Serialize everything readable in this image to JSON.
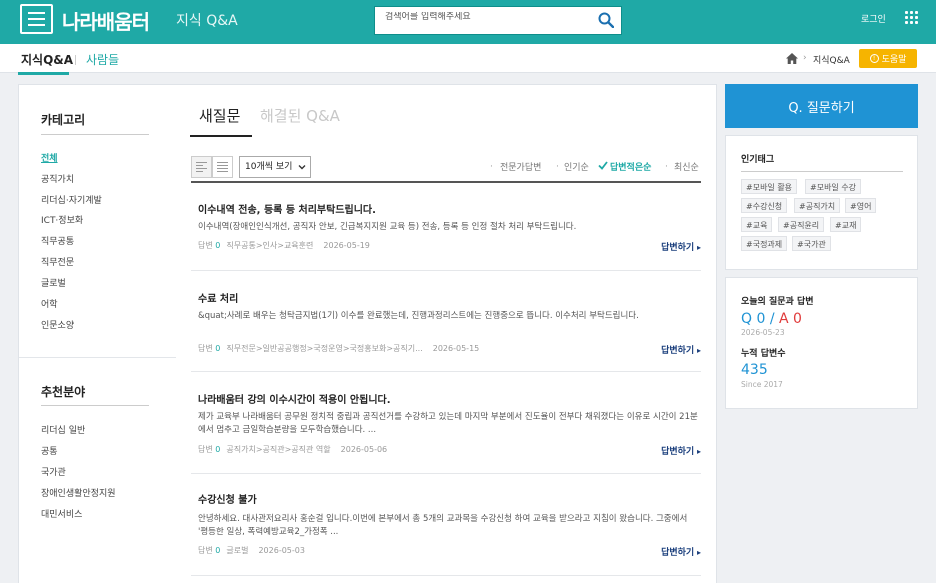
{
  "header": {
    "logo": "나라배움터",
    "section": "지식 Q&A",
    "search_placeholder": "검색어를 입력해주세요",
    "login_label": "로그인"
  },
  "subnav": {
    "tabs": [
      "지식Q&A",
      "사람들"
    ],
    "breadcrumb": "지식Q&A",
    "help_label": "도움말"
  },
  "sidebar": {
    "category_title": "카테고리",
    "categories": [
      "전체",
      "공직가치",
      "리더십·자기계발",
      "ICT·정보화",
      "직무공통",
      "직무전문",
      "글로벌",
      "어학",
      "인문소양"
    ],
    "recommend_title": "추천분야",
    "recommends": [
      "리더십 일반",
      "공통",
      "국가관",
      "장애인생활안정지원",
      "대민서비스"
    ]
  },
  "content": {
    "tabs": [
      "새질문",
      "해결된 Q&A"
    ],
    "per_page": "10개씩 보기",
    "sorts": [
      "전문가답변",
      "인기순",
      "답변적은순",
      "최신순"
    ],
    "active_sort": "답변적은순",
    "answer_label": "답변하기",
    "reply_prefix": "답변",
    "questions": [
      {
        "title": "이수내역 전송, 등록 등 처리부탁드립니다.",
        "body": "이수내역(장애인인식개선, 공직자 안보, 긴급복지지원 교육 등) 전송, 등록 등 인정 절차 처리 부탁드립니다.",
        "answers": "0",
        "category": "직무공통>인사>교육훈련",
        "date": "2026-05-19"
      },
      {
        "title": "수료 처리",
        "body": "&quat;사례로 배우는 청탁금지법(1기) 이수를 완료했는데, 진행과정리스트에는 진행중으로 뜹니다. 이수처리 부탁드립니다.",
        "answers": "0",
        "category": "직무전문>일반공공행정>국정운영>국정홍보화>공직기...",
        "date": "2026-05-15"
      },
      {
        "title": "나라배움터 강의 이수시간이 적용이 안됩니다.",
        "body": "제가 교육부 나라배움터 공무원 정치적 중립과 공직선거를 수강하고 있는데 마지막 부분에서 진도율이 전부다 채워졌다는 이유로 시간이 21분에서 멈추고 금일학습분량을 모두학습했습니다. ...",
        "answers": "0",
        "category": "공직가치>공직관>공직관 역할",
        "date": "2026-05-06"
      },
      {
        "title": "수강신청 불가",
        "body": "안녕하세요. 대사관저요리사 홍순걸 입니다.이번에 본부에서 총 5개의 교과목을 수강신청 하여 교육을 받으라고 지침이 왔습니다. 그중에서 '평등한 일상, 폭력예방교육2_가정폭 ...",
        "answers": "0",
        "category": "글로벌",
        "date": "2026-05-03"
      }
    ]
  },
  "right": {
    "ask_label": "Q. 질문하기",
    "tags_title": "인기태그",
    "tags": [
      "#모바일 활용",
      "#모바일 수강",
      "#수강신청",
      "#공직가치",
      "#영어",
      "#교육",
      "#공직윤리",
      "#교재",
      "#국정과제",
      "#국가관"
    ],
    "today_label": "오늘의 질문과 답변",
    "today_q": "Q 0",
    "today_sep": " / ",
    "today_a": "A 0",
    "today_date": "2026-05-23",
    "total_label": "누적 답변수",
    "total_value": "435",
    "since": "Since 2017"
  },
  "colors": {
    "brand": "#1fa9a6",
    "ask_button": "#1f93d4",
    "help_button": "#f6b400",
    "answer_link": "#1a3e7c"
  }
}
